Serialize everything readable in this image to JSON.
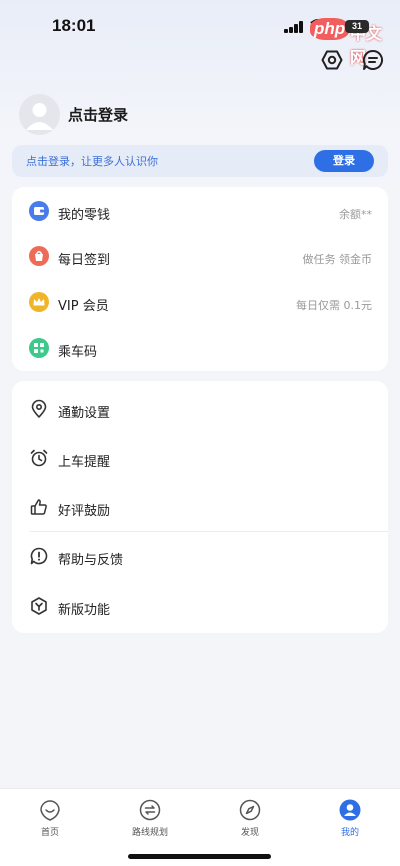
{
  "status_bar": {
    "time": "18:01",
    "battery": "31",
    "watermark_php": "php",
    "watermark_cn": "中文网"
  },
  "header": {
    "icons": [
      "settings-hex-icon",
      "message-icon"
    ]
  },
  "profile": {
    "login_title": "点击登录",
    "banner_text": "点击登录，让更多人认识你",
    "banner_button": "登录"
  },
  "menu_primary": [
    {
      "label": "我的零钱",
      "extra": "余额**",
      "icon": "wallet-icon",
      "color": "#4a7bea"
    },
    {
      "label": "每日签到",
      "extra": "做任务 领金币",
      "icon": "sign-in-icon",
      "color": "#ee6b57"
    },
    {
      "label": "VIP 会员",
      "extra": "每日仅需 0.1元",
      "icon": "crown-icon",
      "color": "#f0b429"
    },
    {
      "label": "乘车码",
      "extra": "",
      "icon": "qrcode-icon",
      "color": "#3cc98a"
    }
  ],
  "menu_secondary": [
    {
      "label": "通勤设置",
      "icon": "location-pin-icon"
    },
    {
      "label": "上车提醒",
      "icon": "alarm-clock-icon"
    },
    {
      "label": "好评鼓励",
      "icon": "thumbs-up-icon"
    },
    {
      "label": "帮助与反馈",
      "icon": "help-feedback-icon"
    },
    {
      "label": "新版功能",
      "icon": "new-feature-icon"
    }
  ],
  "tabbar": [
    {
      "label": "首页",
      "icon": "home-tab-icon",
      "active": false
    },
    {
      "label": "路线规划",
      "icon": "route-tab-icon",
      "active": false
    },
    {
      "label": "发现",
      "icon": "compass-tab-icon",
      "active": false
    },
    {
      "label": "我的",
      "icon": "profile-tab-icon",
      "active": true
    }
  ],
  "colors": {
    "accent": "#2f6fe6",
    "background": "#f4f5f8",
    "banner_bg": "#e6ecf7"
  }
}
